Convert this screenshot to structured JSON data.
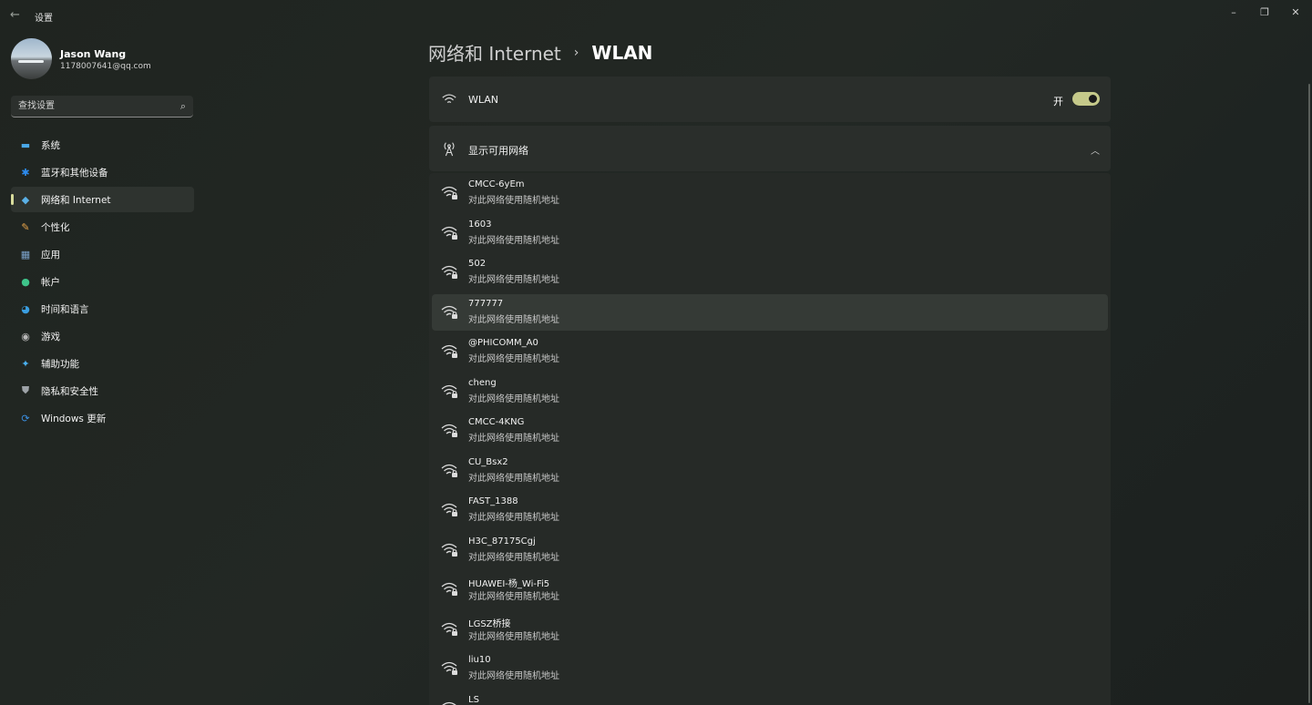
{
  "window": {
    "title": "设置",
    "minimize": "–",
    "restore": "❐",
    "close": "✕"
  },
  "user": {
    "name": "Jason Wang",
    "email": "1178007641@qq.com"
  },
  "search": {
    "placeholder": "查找设置"
  },
  "nav": [
    {
      "label": "系统",
      "icon": "system-icon",
      "color": "#4aa8e8",
      "glyph": "▬"
    },
    {
      "label": "蓝牙和其他设备",
      "icon": "bluetooth-icon",
      "color": "#2d8cf0",
      "glyph": "✱"
    },
    {
      "label": "网络和 Internet",
      "icon": "wifi-icon",
      "color": "#5ab0e6",
      "glyph": "◆",
      "active": true
    },
    {
      "label": "个性化",
      "icon": "brush-icon",
      "color": "#e8a44a",
      "glyph": "✎"
    },
    {
      "label": "应用",
      "icon": "apps-icon",
      "color": "#7aa0c8",
      "glyph": "▦"
    },
    {
      "label": "帐户",
      "icon": "account-icon",
      "color": "#3ec48a",
      "glyph": "●"
    },
    {
      "label": "时间和语言",
      "icon": "globe-clock-icon",
      "color": "#3a9ee0",
      "glyph": "◕"
    },
    {
      "label": "游戏",
      "icon": "gamepad-icon",
      "color": "#b8b8b8",
      "glyph": "◉"
    },
    {
      "label": "辅助功能",
      "icon": "accessibility-icon",
      "color": "#4ab0f0",
      "glyph": "✦"
    },
    {
      "label": "隐私和安全性",
      "icon": "shield-icon",
      "color": "#9ea3a8",
      "glyph": "⛊"
    },
    {
      "label": "Windows 更新",
      "icon": "update-icon",
      "color": "#3a8ee0",
      "glyph": "⟳"
    }
  ],
  "breadcrumb": {
    "parent": "网络和 Internet",
    "separator": "›",
    "current": "WLAN"
  },
  "wlan": {
    "label": "WLAN",
    "state": "开",
    "on": true
  },
  "available": {
    "label": "显示可用网络",
    "expanded": true
  },
  "networks": [
    {
      "name": "CMCC-6yEm",
      "sub": "对此网络使用随机地址"
    },
    {
      "name": "1603",
      "sub": "对此网络使用随机地址"
    },
    {
      "name": "502",
      "sub": "对此网络使用随机地址"
    },
    {
      "name": "777777",
      "sub": "对此网络使用随机地址",
      "hover": true
    },
    {
      "name": "@PHICOMM_A0",
      "sub": "对此网络使用随机地址"
    },
    {
      "name": "cheng",
      "sub": "对此网络使用随机地址"
    },
    {
      "name": "CMCC-4KNG",
      "sub": "对此网络使用随机地址"
    },
    {
      "name": "CU_Bsx2",
      "sub": "对此网络使用随机地址"
    },
    {
      "name": "FAST_1388",
      "sub": "对此网络使用随机地址"
    },
    {
      "name": "H3C_87175Cgj",
      "sub": "对此网络使用随机地址"
    },
    {
      "name": "HUAWEI-杨_Wi-Fi5",
      "sub": "对此网络使用随机地址"
    },
    {
      "name": "LGSZ桥接",
      "sub": "对此网络使用随机地址"
    },
    {
      "name": "liu10",
      "sub": "对此网络使用随机地址"
    },
    {
      "name": "LS",
      "sub": ""
    }
  ]
}
